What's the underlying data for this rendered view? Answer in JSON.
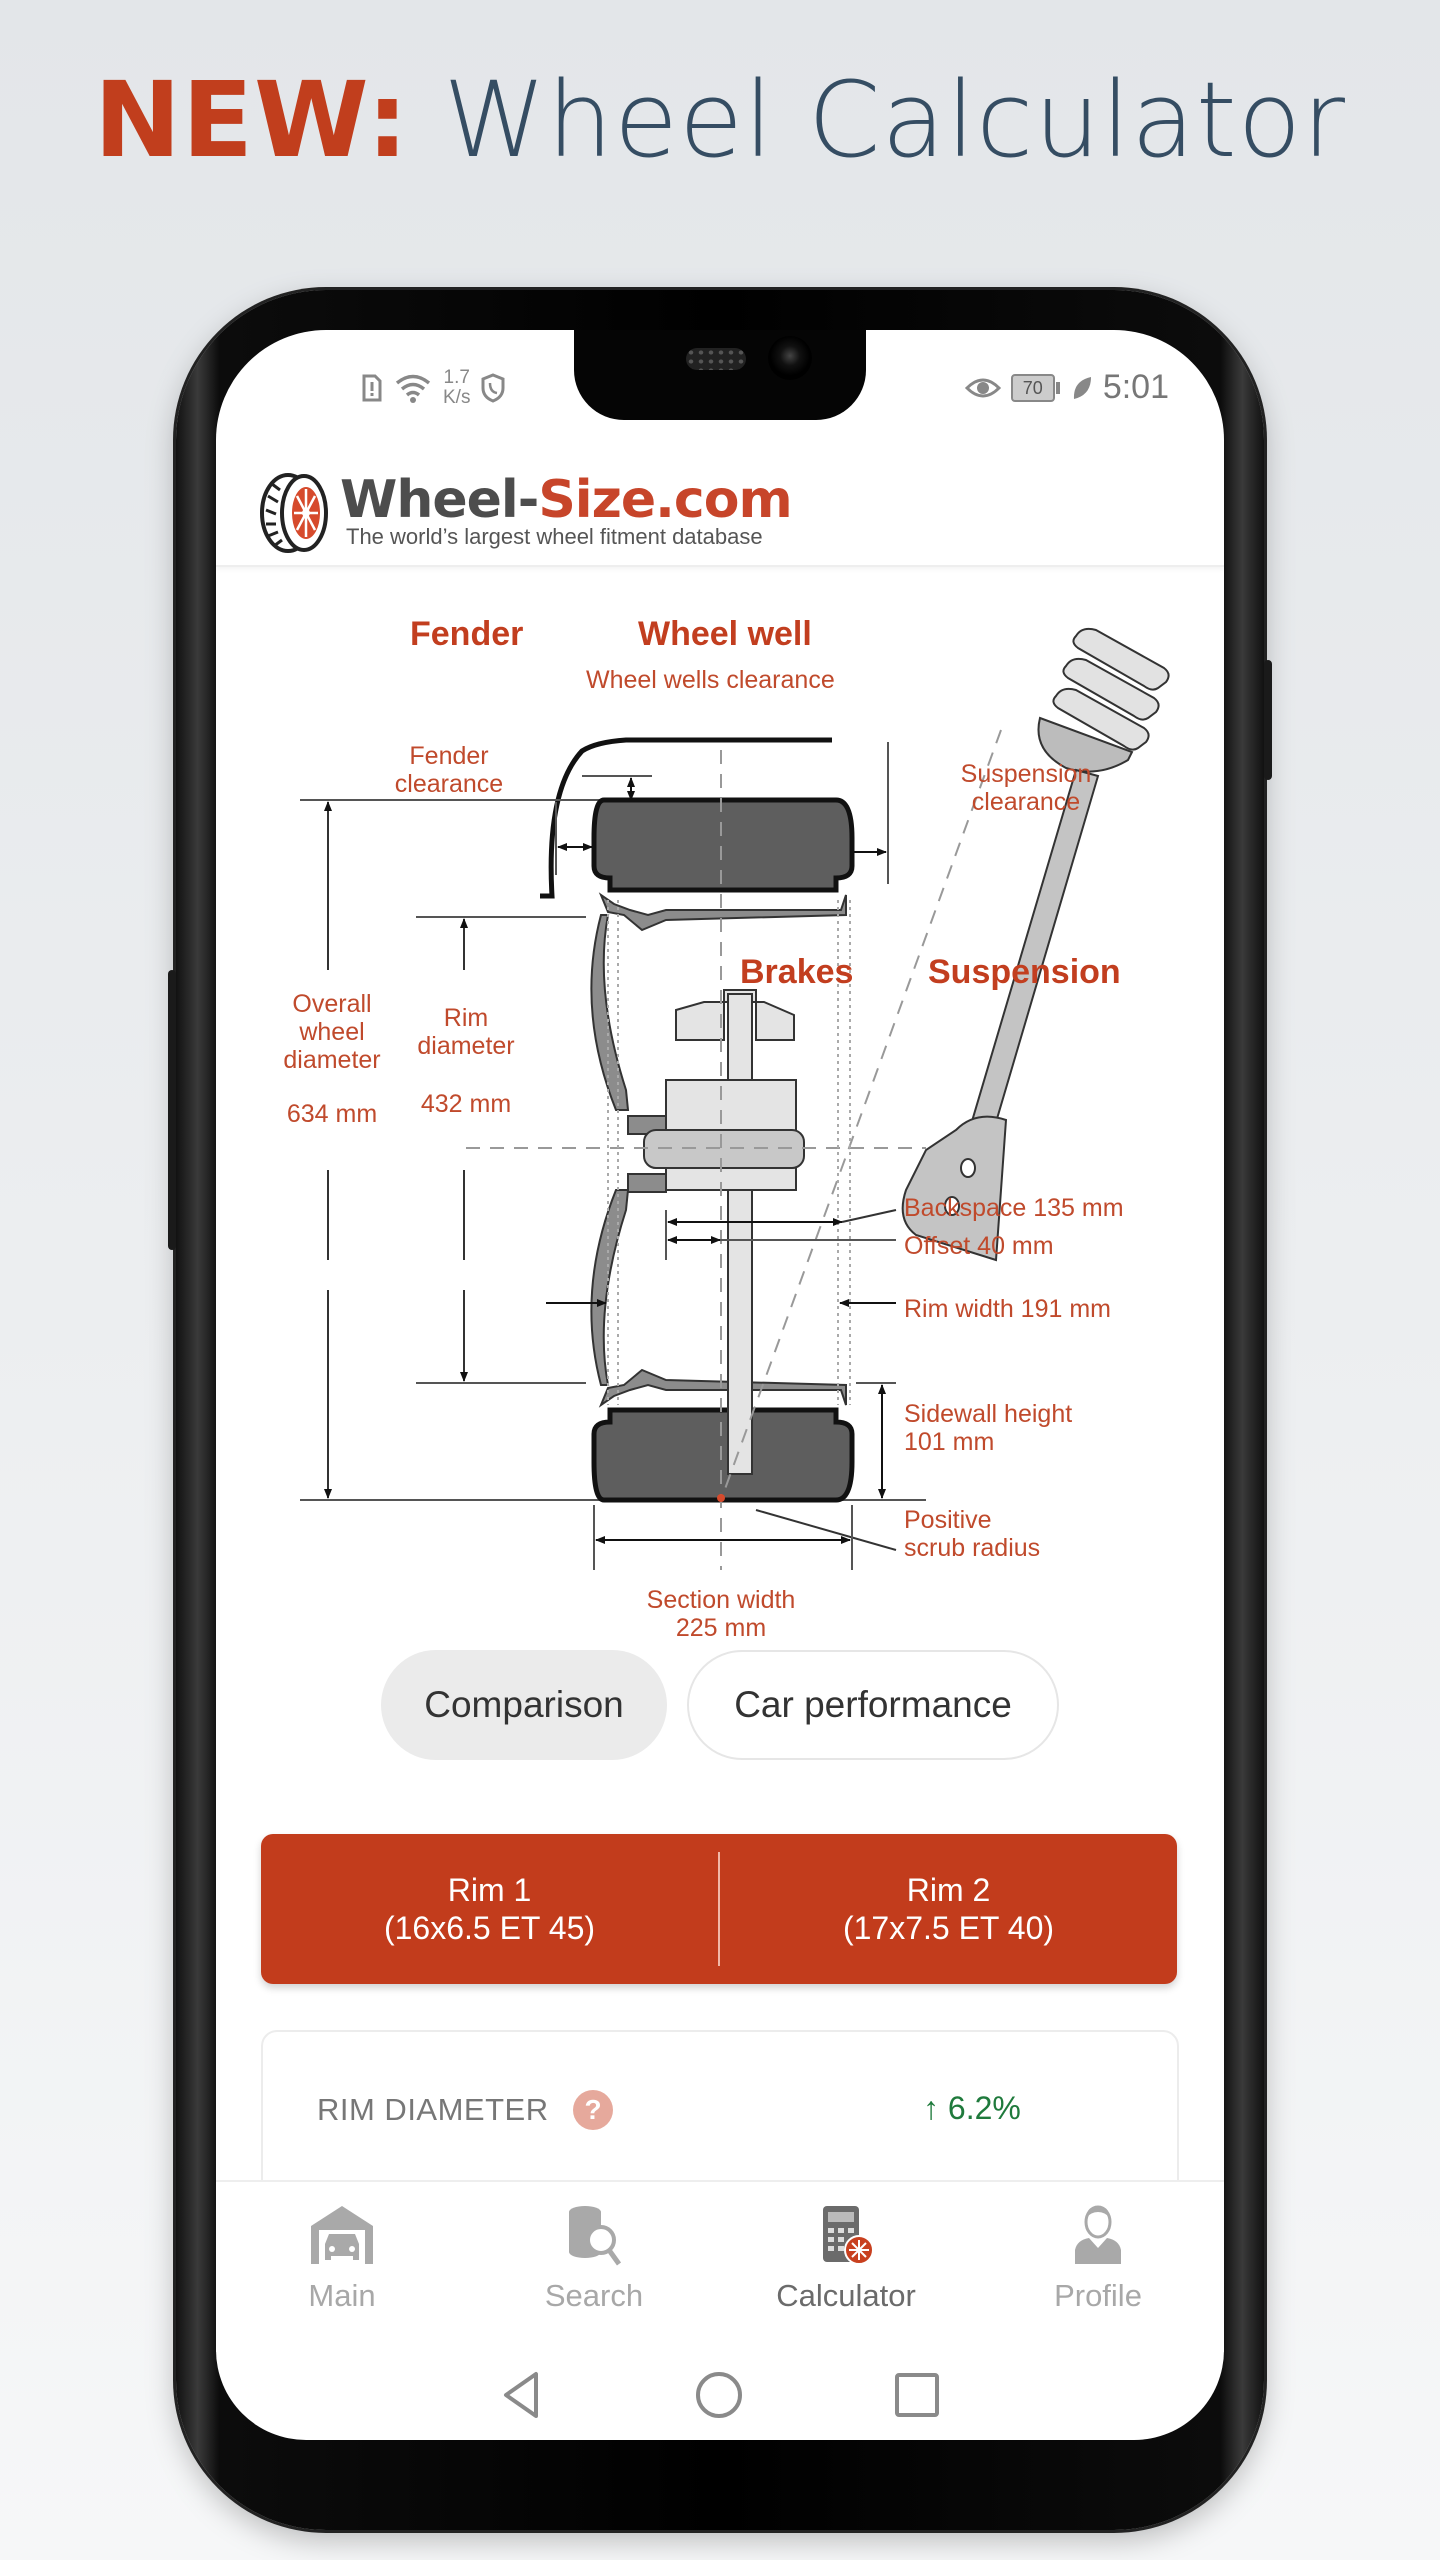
{
  "headline": {
    "new": "NEW:",
    "rest": "Wheel Calculator"
  },
  "status_bar": {
    "left_icons": [
      "sim-alert-icon",
      "wifi-icon",
      "shield-call-icon"
    ],
    "net_speed_value": "1.7",
    "net_speed_unit": "K/s",
    "right_icons": [
      "eye-icon",
      "battery-icon",
      "leaf-icon"
    ],
    "battery": "70",
    "time": "5:01"
  },
  "header": {
    "brand_part1": "Wheel-",
    "brand_part2": "Size.com",
    "tagline": "The world’s largest wheel fitment database"
  },
  "diagram": {
    "fender": "Fender",
    "wheel_well": "Wheel well",
    "wheel_wells_clearance": "Wheel wells clearance",
    "fender_clearance": [
      "Fender",
      "clearance"
    ],
    "suspension_clearance": [
      "Suspension",
      "clearance"
    ],
    "brakes": "Brakes",
    "suspension": "Suspension",
    "overall_diameter": [
      "Overall",
      "wheel",
      "diameter"
    ],
    "overall_diameter_value": "634 mm",
    "rim_diameter": [
      "Rim",
      "diameter"
    ],
    "rim_diameter_value": "432 mm",
    "backspace": "Backspace 135 mm",
    "offset": "Offset 40 mm",
    "rim_width": "Rim width 191 mm",
    "sidewall": [
      "Sidewall height",
      "101 mm"
    ],
    "scrub": [
      "Positive",
      "scrub radius"
    ],
    "section_width": [
      "Section width",
      "225 mm"
    ]
  },
  "mode_tabs": [
    {
      "label": "Comparison",
      "active": true
    },
    {
      "label": "Car performance",
      "active": false
    }
  ],
  "rims": [
    {
      "title": "Rim 1",
      "spec": "(16x6.5 ET 45)"
    },
    {
      "title": "Rim 2",
      "spec": "(17x7.5 ET 40)"
    }
  ],
  "comparison": {
    "label": "RIM DIAMETER",
    "help": "?",
    "arrow": "↑",
    "value": "6.2%",
    "color": "#1f7a3c"
  },
  "bottom_nav": [
    {
      "label": "Main",
      "icon": "garage-car-icon",
      "active": false
    },
    {
      "label": "Search",
      "icon": "database-search-icon",
      "active": false
    },
    {
      "label": "Calculator",
      "icon": "calculator-wheel-icon",
      "active": true
    },
    {
      "label": "Profile",
      "icon": "person-icon",
      "active": false
    }
  ],
  "system_nav": [
    "back-icon",
    "home-icon",
    "recents-icon"
  ],
  "colors": {
    "accent": "#c23c1c",
    "title_text": "#354d63",
    "positive": "#1f7a3c"
  }
}
